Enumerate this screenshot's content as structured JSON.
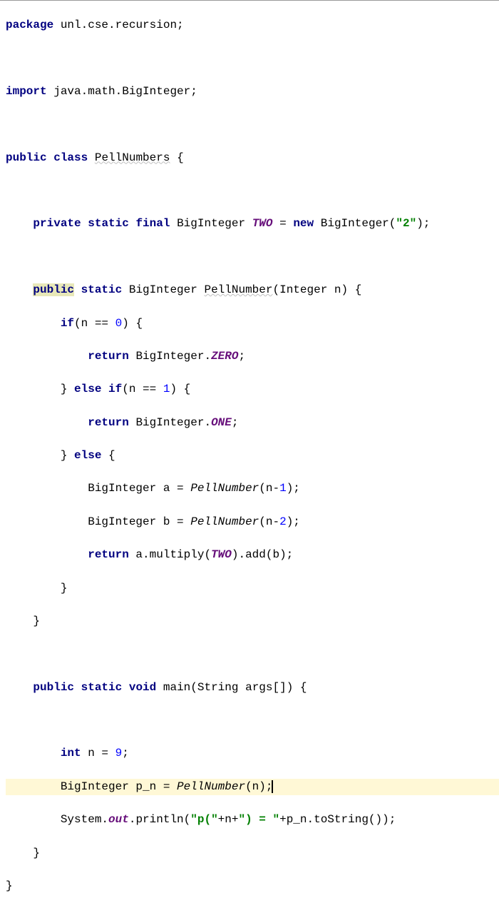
{
  "code": {
    "pkg_kw": "package",
    "pkg_name": " unl.cse.recursion;",
    "import_kw": "import",
    "import_name": " java.math.BigInteger;",
    "public_kw": "public",
    "class_kw": "class",
    "class_name": "PellNumbers",
    "obrace": " {",
    "private_kw": "private",
    "static_kw": "static",
    "final_kw": "final",
    "bigint": "BigInteger",
    "two_field": "TWO",
    "eq": " = ",
    "new_kw": "new",
    "two_str": "\"2\"",
    "semi": ";",
    "pellnum_name": "PellNumber",
    "integer_type": "Integer",
    "n_param": "n",
    "if_kw": "if",
    "n_eq0": "(n == ",
    "zero": "0",
    "cparen_obrace": ") {",
    "return_kw": "return",
    "zero_field": "ZERO",
    "cbrace": "}",
    "else_kw": "else",
    "n_eq1": "(n == ",
    "one": "1",
    "one_field": "ONE",
    "a_decl": " a = ",
    "pellnum_call": "PellNumber",
    "n_minus1": "(n-",
    "n_minus2": "(n-",
    "two_num": "2",
    "one_num": "1",
    "b_decl": " b = ",
    "mult_call": " a.multiply(",
    "add_call": ").add(b);",
    "void_kw": "void",
    "main_name": "main",
    "string_type": "String",
    "args": " args[]) {",
    "int_kw": "int",
    "n_eq9": " n = ",
    "nine": "9",
    "pn_decl": " p_n = ",
    "pn_call_close": "(n);",
    "sys": "System.",
    "out_field": "out",
    "println": ".println(",
    "str1": "\"p(\"",
    "plus_n": "+n+",
    "str2": "\") = \"",
    "plus_pn": "+p_n.toString());"
  }
}
